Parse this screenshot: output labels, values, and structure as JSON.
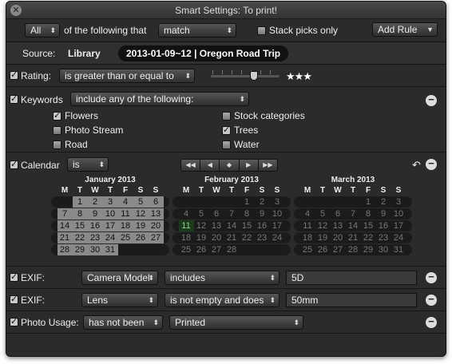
{
  "window": {
    "title": "Smart Settings: To print!"
  },
  "toolbar": {
    "match_scope": "All",
    "of_following": "of the following that",
    "match_mode": "match",
    "stack_picks_label": "Stack picks only",
    "add_rule": "Add Rule"
  },
  "source": {
    "label": "Source:",
    "library": "Library",
    "project": "2013-01-09~12 | Oregon Road Trip"
  },
  "rating": {
    "label": "Rating:",
    "operator": "is greater than or equal to",
    "stars": "★★★",
    "value": 3
  },
  "keywords": {
    "label": "Keywords",
    "operator": "include any of the following:",
    "items": [
      {
        "label": "Flowers",
        "checked": true
      },
      {
        "label": "Photo Stream",
        "checked": false
      },
      {
        "label": "Road",
        "checked": false
      },
      {
        "label": "Stock categories",
        "checked": false
      },
      {
        "label": "Trees",
        "checked": true
      },
      {
        "label": "Water",
        "checked": false
      }
    ]
  },
  "calendar": {
    "label": "Calendar",
    "operator": "is",
    "nav": [
      "◀◀",
      "◀",
      "◆",
      "▶",
      "▶▶"
    ],
    "day_headers": [
      "M",
      "T",
      "W",
      "T",
      "F",
      "S",
      "S"
    ],
    "months": [
      {
        "name": "January 2013",
        "weeks": [
          [
            "",
            "1",
            "2",
            "3",
            "4",
            "5",
            "6"
          ],
          [
            "7",
            "8",
            "9",
            "10",
            "11",
            "12",
            "13"
          ],
          [
            "14",
            "15",
            "16",
            "17",
            "18",
            "19",
            "20"
          ],
          [
            "21",
            "22",
            "23",
            "24",
            "25",
            "26",
            "27"
          ],
          [
            "28",
            "29",
            "30",
            "31",
            "",
            "",
            ""
          ]
        ]
      },
      {
        "name": "February 2013",
        "weeks": [
          [
            "",
            "",
            "",
            "",
            "1",
            "2",
            "3"
          ],
          [
            "4",
            "5",
            "6",
            "7",
            "8",
            "9",
            "10"
          ],
          [
            "11",
            "12",
            "13",
            "14",
            "15",
            "16",
            "17"
          ],
          [
            "18",
            "19",
            "20",
            "21",
            "22",
            "23",
            "24"
          ],
          [
            "25",
            "26",
            "27",
            "28",
            "",
            "",
            ""
          ]
        ]
      },
      {
        "name": "March 2013",
        "weeks": [
          [
            "",
            "",
            "",
            "",
            "1",
            "2",
            "3"
          ],
          [
            "4",
            "5",
            "6",
            "7",
            "8",
            "9",
            "10"
          ],
          [
            "11",
            "12",
            "13",
            "14",
            "15",
            "16",
            "17"
          ],
          [
            "18",
            "19",
            "20",
            "21",
            "22",
            "23",
            "24"
          ],
          [
            "25",
            "26",
            "27",
            "28",
            "29",
            "30",
            "31"
          ]
        ]
      }
    ]
  },
  "exif1": {
    "label": "EXIF:",
    "field": "Camera Model",
    "operator": "includes",
    "value": "5D"
  },
  "exif2": {
    "label": "EXIF:",
    "field": "Lens",
    "operator": "is not empty and does",
    "value": "50mm"
  },
  "photo_usage": {
    "label": "Photo Usage:",
    "operator": "has not been",
    "value": "Printed"
  }
}
